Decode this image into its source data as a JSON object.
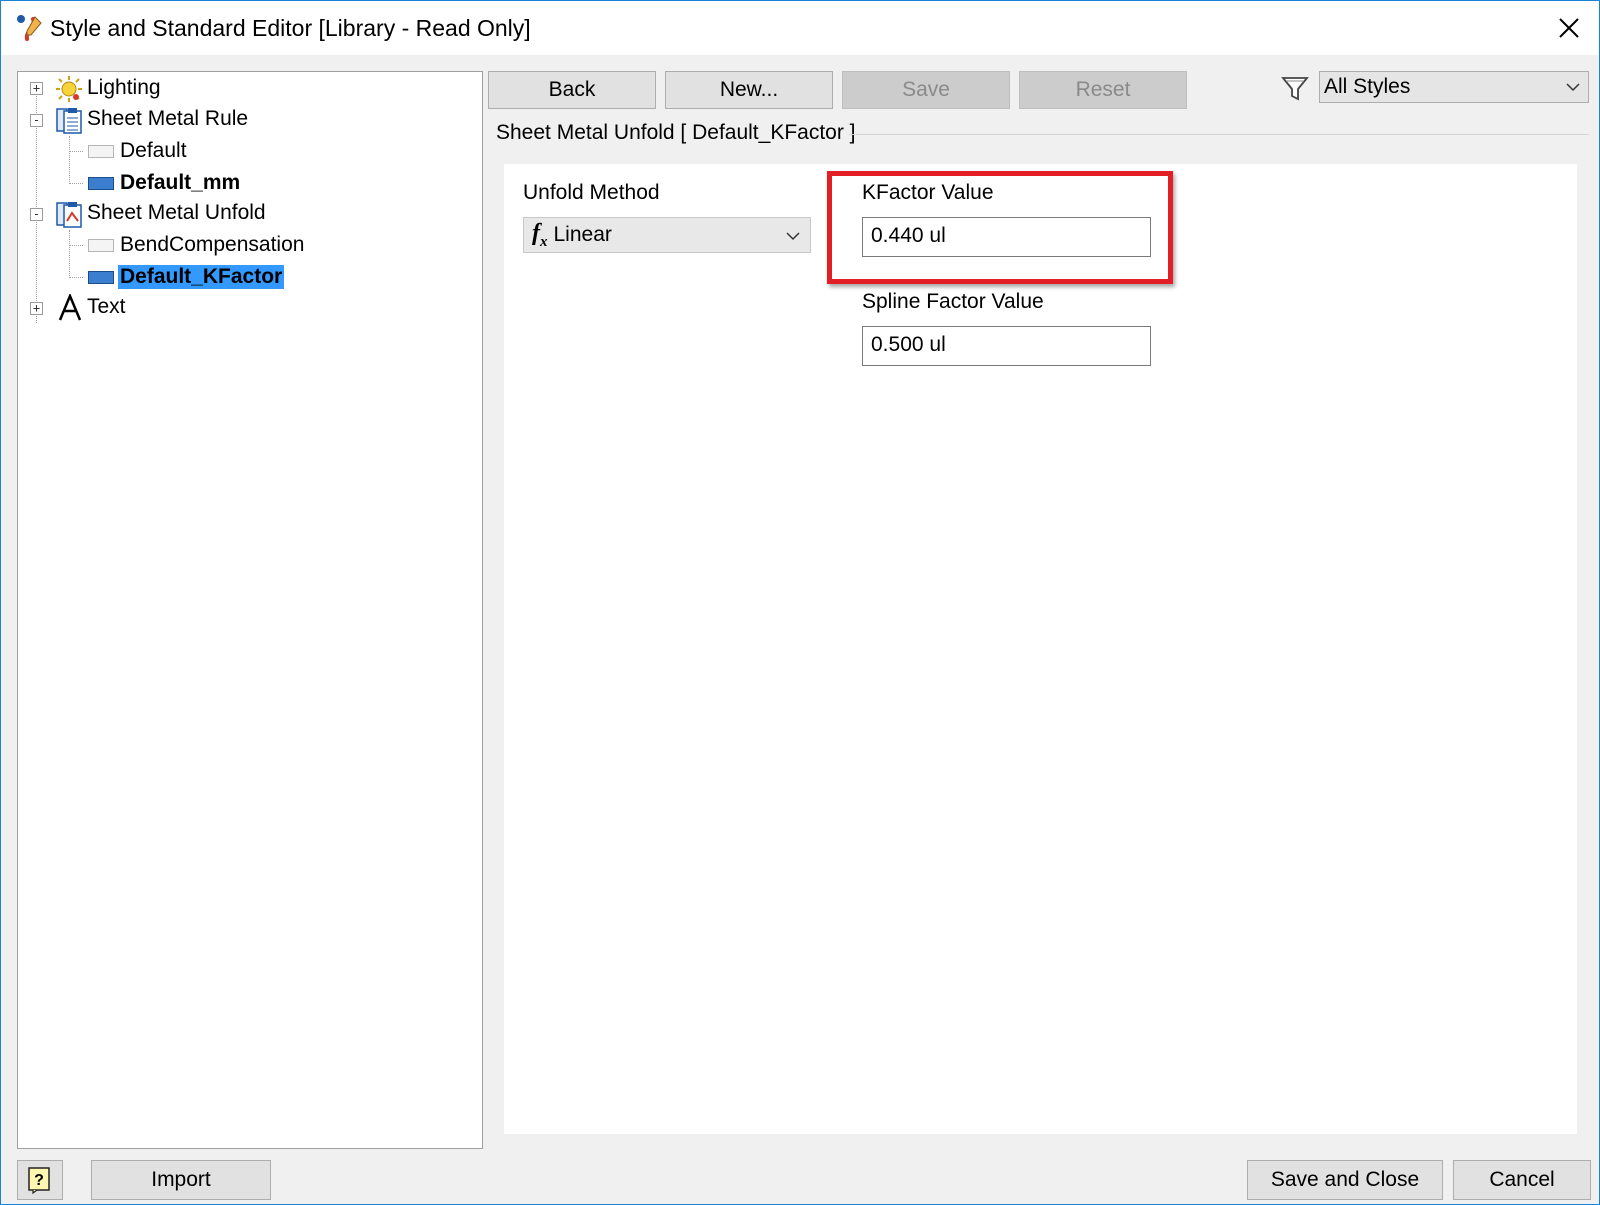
{
  "window": {
    "title": "Style and Standard Editor [Library - Read Only]",
    "accent_color": "#1883d7"
  },
  "tree": {
    "items": [
      {
        "label": "Lighting",
        "icon": "lighting-icon",
        "expander": "+"
      },
      {
        "label": "Sheet Metal Rule",
        "icon": "sheet-metal-rule-icon",
        "expander": "-"
      },
      {
        "label": "Default",
        "icon": "style-swatch-empty"
      },
      {
        "label": "Default_mm",
        "icon": "style-swatch-filled",
        "bold": true
      },
      {
        "label": "Sheet Metal Unfold",
        "icon": "sheet-metal-unfold-icon",
        "expander": "-"
      },
      {
        "label": "BendCompensation",
        "icon": "style-swatch-empty"
      },
      {
        "label": "Default_KFactor",
        "icon": "style-swatch-filled",
        "bold": true,
        "selected": true
      },
      {
        "label": "Text",
        "icon": "text-style-icon",
        "expander": "+"
      }
    ],
    "selection_color": "#3399ff"
  },
  "toolbar": {
    "back_label": "Back",
    "new_label": "New...",
    "save_label": "Save",
    "reset_label": "Reset",
    "filter_value": "All Styles"
  },
  "section": {
    "header": "Sheet Metal Unfold [ Default_KFactor ]"
  },
  "form": {
    "unfold_method_label": "Unfold Method",
    "unfold_method_value": "Linear",
    "unfold_method_icon": "fx",
    "kfactor_label": "KFactor Value",
    "kfactor_value": "0.440 ul",
    "spline_label": "Spline Factor Value",
    "spline_value": "0.500 ul",
    "highlight_color": "#e31e24"
  },
  "footer": {
    "import_label": "Import",
    "save_close_label": "Save and Close",
    "cancel_label": "Cancel"
  }
}
